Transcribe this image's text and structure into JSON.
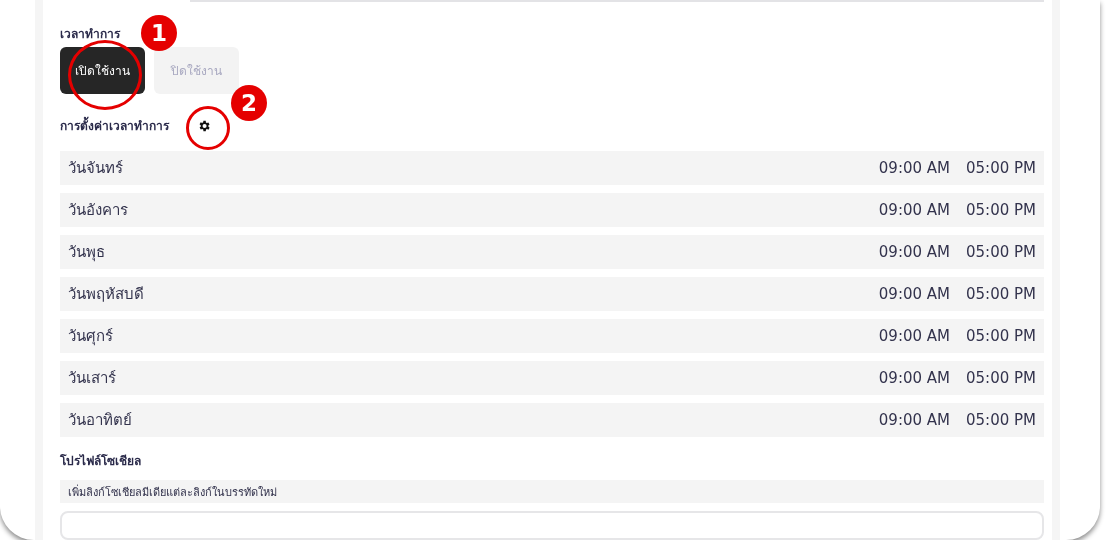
{
  "hours": {
    "label": "เวลาทำการ",
    "options": [
      {
        "label": "เปิดใช้งาน",
        "selected": true
      },
      {
        "label": "ปิดใช้งาน",
        "selected": false
      }
    ],
    "settings_label": "การตั้งค่าเวลาทำการ",
    "days": [
      {
        "day": "วันจันทร์",
        "open": "09:00 AM",
        "close": "05:00 PM"
      },
      {
        "day": "วันอังคาร",
        "open": "09:00 AM",
        "close": "05:00 PM"
      },
      {
        "day": "วันพุธ",
        "open": "09:00 AM",
        "close": "05:00 PM"
      },
      {
        "day": "วันพฤหัสบดี",
        "open": "09:00 AM",
        "close": "05:00 PM"
      },
      {
        "day": "วันศุกร์",
        "open": "09:00 AM",
        "close": "05:00 PM"
      },
      {
        "day": "วันเสาร์",
        "open": "09:00 AM",
        "close": "05:00 PM"
      },
      {
        "day": "วันอาทิตย์",
        "open": "09:00 AM",
        "close": "05:00 PM"
      }
    ]
  },
  "social": {
    "label": "โปรไฟล์โซเชียล",
    "hint": "เพิ่มลิงก์โซเชียลมีเดียแต่ละลิงก์ในบรรทัดใหม่"
  },
  "annotations": [
    {
      "number": "1"
    },
    {
      "number": "2"
    }
  ]
}
